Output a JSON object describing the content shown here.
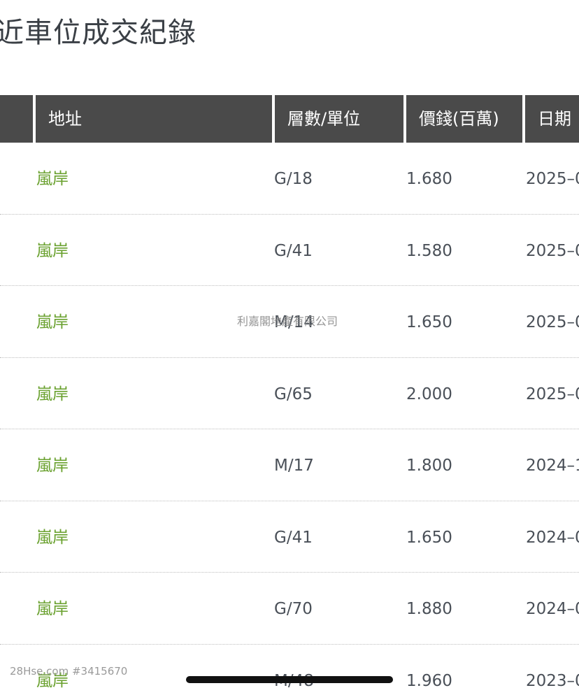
{
  "title": "近車位成交紀錄",
  "table": {
    "headers": [
      "",
      "地址",
      "層數/單位",
      "價錢(百萬)",
      "日期"
    ],
    "rows": [
      {
        "address": "嵐岸",
        "unit": "G/18",
        "price": "1.680",
        "date": "2025–0"
      },
      {
        "address": "嵐岸",
        "unit": "G/41",
        "price": "1.580",
        "date": "2025–0"
      },
      {
        "address": "嵐岸",
        "unit": "M/14",
        "price": "1.650",
        "date": "2025–0"
      },
      {
        "address": "嵐岸",
        "unit": "G/65",
        "price": "2.000",
        "date": "2025–0"
      },
      {
        "address": "嵐岸",
        "unit": "M/17",
        "price": "1.800",
        "date": "2024–1"
      },
      {
        "address": "嵐岸",
        "unit": "G/41",
        "price": "1.650",
        "date": "2024–0"
      },
      {
        "address": "嵐岸",
        "unit": "G/70",
        "price": "1.880",
        "date": "2024–0"
      },
      {
        "address": "嵐岸",
        "unit": "M/48",
        "price": "1.960",
        "date": "2023–0"
      }
    ]
  },
  "watermark_center": "利嘉閣地產有限公司",
  "watermark_bottom": "28Hse.com #3415670",
  "colors": {
    "header_bg": "#4a4a4a",
    "address_link": "#6aa12f",
    "text": "#4a5058"
  }
}
